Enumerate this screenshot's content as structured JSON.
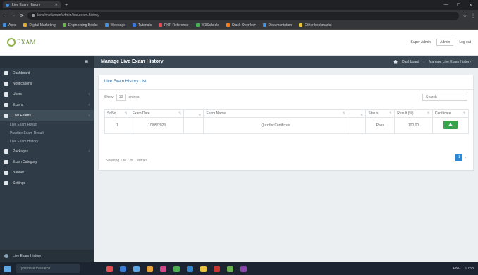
{
  "browser": {
    "tab_title": "Live Exam History",
    "new_tab": "+",
    "window_controls": [
      "—",
      "☐",
      "✕"
    ],
    "nav": [
      "←",
      "→",
      "⟳"
    ],
    "url": "localhost/exam/admin/live-exam-history",
    "extensions": [
      "☆",
      "⋮"
    ],
    "bookmarks": [
      {
        "label": "Apps",
        "color": "#4a90d9"
      },
      {
        "label": "Digital Marketing",
        "color": "#e8a23a"
      },
      {
        "label": "Engineering Books",
        "color": "#6ab04c"
      },
      {
        "label": "Webpage",
        "color": "#4a90d9"
      },
      {
        "label": "Tutorials",
        "color": "#3a7bd5"
      },
      {
        "label": "PHP Reference",
        "color": "#e05252"
      },
      {
        "label": "W3Schools",
        "color": "#4caf50"
      },
      {
        "label": "Stack Overflow",
        "color": "#f48024"
      },
      {
        "label": "Documentation",
        "color": "#4a90d9"
      },
      {
        "label": "Other bookmarks",
        "color": "#e8c23a"
      }
    ]
  },
  "header": {
    "logo_text": "EXAM",
    "user_select": "Admin",
    "user_label": "Super Admin",
    "logout": "Log out"
  },
  "sidebar": {
    "toggle": "≡",
    "items": [
      {
        "label": "Dashboard",
        "chev": ""
      },
      {
        "label": "Notifications",
        "chev": ""
      },
      {
        "label": "Users",
        "chev": "‹"
      },
      {
        "label": "Exams",
        "chev": "‹"
      },
      {
        "label": "Live Exams",
        "chev": "‹",
        "active": true
      }
    ],
    "subitems": [
      "Live Exam Result",
      "Practice Exam Result",
      "Live Exam History"
    ],
    "items2": [
      {
        "label": "Packages",
        "chev": "‹"
      },
      {
        "label": "Exam Category",
        "chev": ""
      },
      {
        "label": "Banner",
        "chev": ""
      },
      {
        "label": "Settings",
        "chev": ""
      }
    ],
    "bottom": "Live Exam History"
  },
  "main": {
    "page_title": "Manage Live Exam History",
    "breadcrumb": [
      "Dashboard",
      "Manage Live Exam History"
    ],
    "card_title": "Live Exam History List",
    "show_label": "Show",
    "length_value": "10",
    "entries_label": "entries",
    "search_placeholder": "Search",
    "columns": [
      "Sr.No",
      "Exam Date",
      "",
      "Exam Name",
      "",
      "Status",
      "Result (%)",
      "Certificate"
    ],
    "rows": [
      {
        "srno": "1",
        "date": "10/05/2023",
        "time": "Quiz for Certificate",
        "name": "",
        "extra": "",
        "status": "Pass",
        "result": "100.00"
      }
    ],
    "info": "Showing 1 to 1 of 1 entries",
    "pager": {
      "prev": "‹",
      "page": "1",
      "next": "›"
    }
  },
  "taskbar": {
    "search": "Type here to search",
    "apps": [
      "#e05252",
      "#3a7bd5",
      "#5ca8e6",
      "#e8a23a",
      "#d04a8a",
      "#4caf50",
      "#2f87d0",
      "#e8c23a",
      "#c0392b",
      "#6ab04c",
      "#8e44ad"
    ],
    "time": "10:58",
    "lang": "ENG"
  }
}
